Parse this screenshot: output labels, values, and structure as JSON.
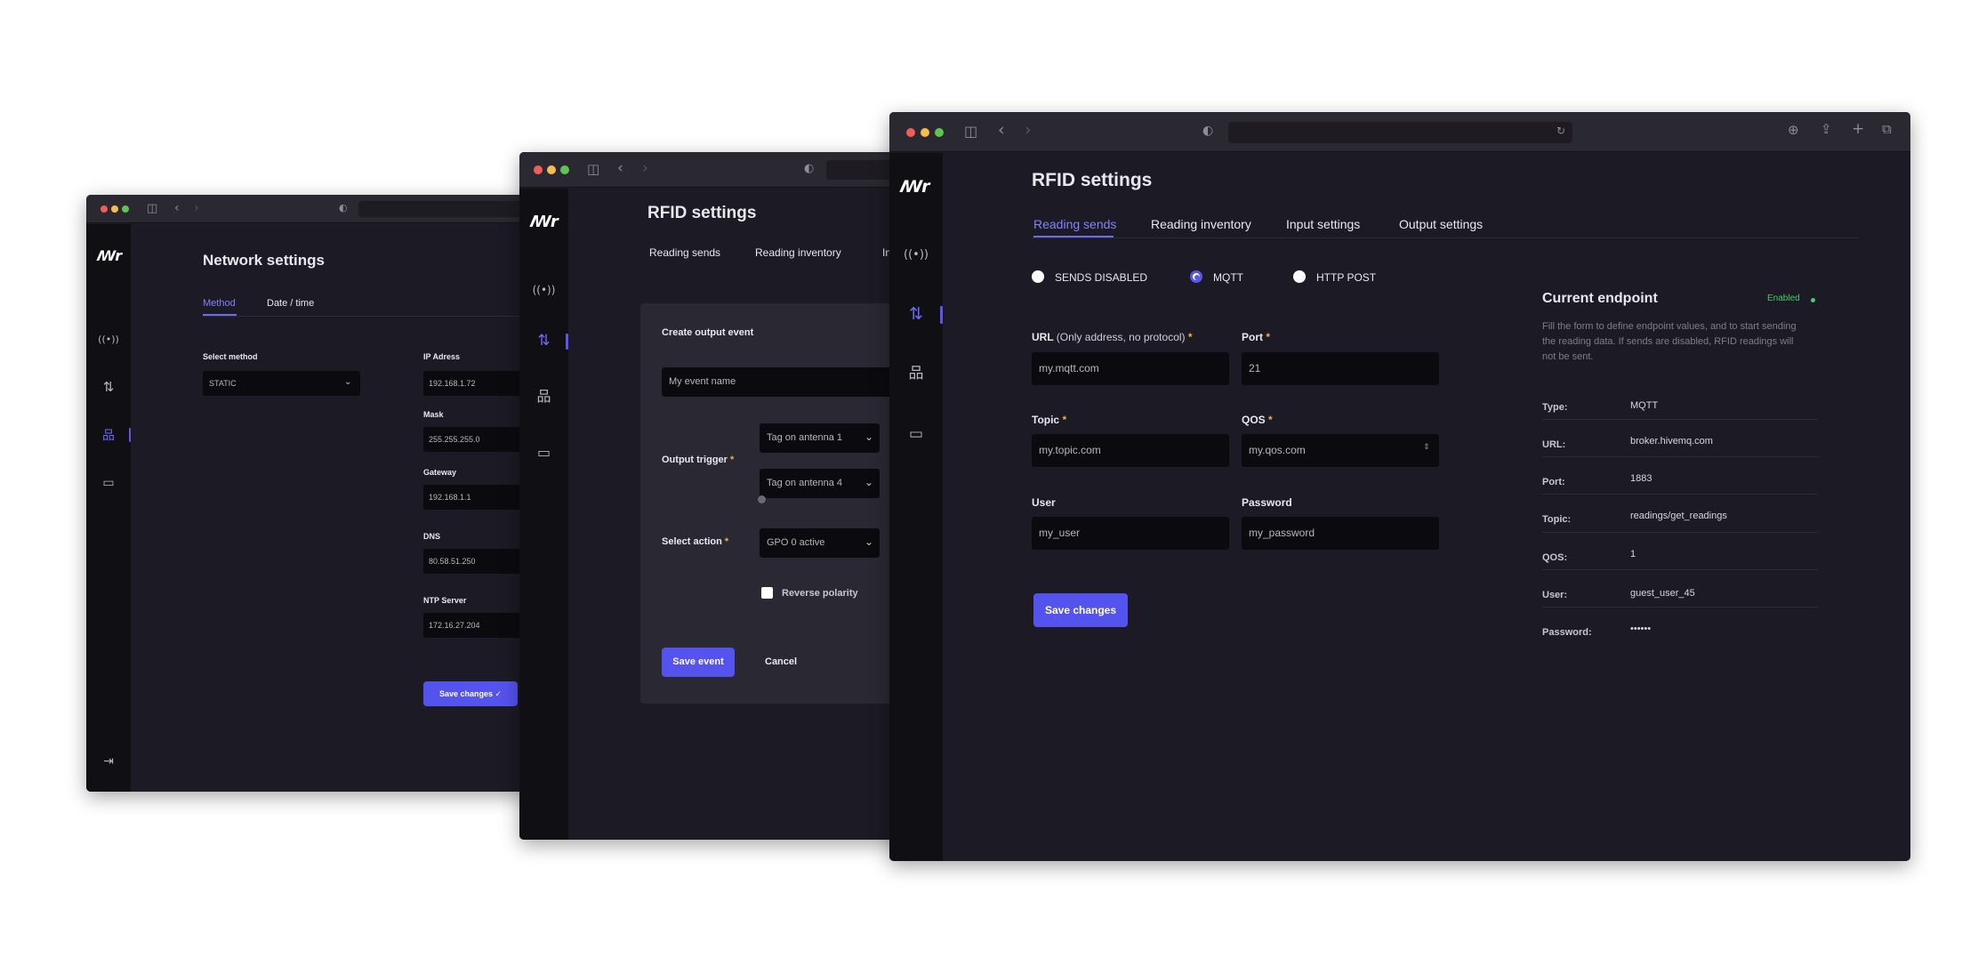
{
  "app": {
    "logo": "ꟿr"
  },
  "win1": {
    "title": "Network settings",
    "tabs": [
      "Method",
      "Date / time"
    ],
    "select_method_label": "Select method",
    "select_method_value": "STATIC",
    "ip_label": "IP Adress",
    "ip_value": "192.168.1.72",
    "mask_label": "Mask",
    "mask_value": "255.255.255.0",
    "gateway_label": "Gateway",
    "gateway_value": "192.168.1.1",
    "dns_label": "DNS",
    "dns_value": "80.58.51.250",
    "ntp_label": "NTP Server",
    "ntp_value": "172.16.27.204",
    "save_label": "Save changes"
  },
  "win2": {
    "title": "RFID settings",
    "tabs": [
      "Reading sends",
      "Reading inventory",
      "In"
    ],
    "panel_title": "Create output event",
    "event_name_placeholder": "My event name",
    "output_trigger_label": "Output trigger",
    "trigger_1": "Tag on antenna 1",
    "trigger_2": "Tag on antenna 4",
    "select_action_label": "Select action",
    "action_value": "GPO 0 active",
    "reverse_polarity_label": "Reverse polarity",
    "save_event_label": "Save event",
    "cancel_label": "Cancel"
  },
  "win3": {
    "title": "RFID settings",
    "tabs": [
      "Reading sends",
      "Reading inventory",
      "Input settings",
      "Output settings"
    ],
    "radio_options": [
      "SENDS DISABLED",
      "MQTT",
      "HTTP POST"
    ],
    "selected_radio": "MQTT",
    "url_label": "URL",
    "url_hint": "(Only address, no protocol)",
    "url_value": "my.mqtt.com",
    "port_label": "Port",
    "port_value": "21",
    "topic_label": "Topic",
    "topic_value": "my.topic.com",
    "qos_label": "QOS",
    "qos_value": "my.qos.com",
    "user_label": "User",
    "user_value": "my_user",
    "password_label": "Password",
    "password_value": "my_password",
    "save_label": "Save changes",
    "endpoint": {
      "title": "Current endpoint",
      "status": "Enabled",
      "description": "Fill the form to define endpoint values, and to start sending the reading data. If sends are disabled, RFID readings will not be sent.",
      "rows": [
        {
          "key": "Type:",
          "value": "MQTT"
        },
        {
          "key": "URL:",
          "value": "broker.hivemq.com"
        },
        {
          "key": "Port:",
          "value": "1883"
        },
        {
          "key": "Topic:",
          "value": "readings/get_readings"
        },
        {
          "key": "QOS:",
          "value": "1"
        },
        {
          "key": "User:",
          "value": "guest_user_45"
        },
        {
          "key": "Password:",
          "value": "••••••"
        }
      ]
    }
  },
  "colors": {
    "accent": "#5553ee",
    "background": "#1c1a24",
    "sidebar": "#100f14",
    "required": "#f0b040",
    "enabled": "#3fcf6a"
  }
}
